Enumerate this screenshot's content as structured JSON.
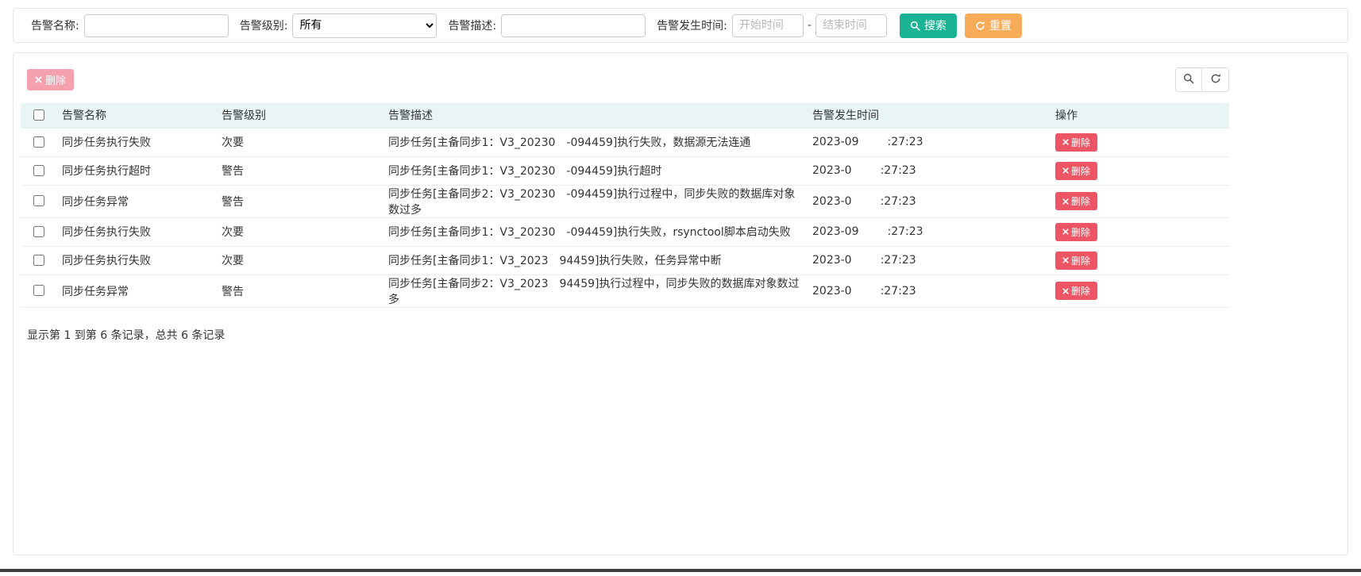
{
  "colors": {
    "search_button": "#1ab394",
    "reset_button": "#f8ac59",
    "delete_button": "#ed5565",
    "delete_button_disabled": "#f5a0ad",
    "table_header_bg": "#e9f5f5"
  },
  "icons": {
    "search": "magnifier",
    "reset": "refresh-arrows",
    "delete": "x-cross",
    "toolbar_search": "magnifier",
    "toolbar_refresh": "refresh-arrows"
  },
  "filters": {
    "name_label": "告警名称:",
    "level_label": "告警级别:",
    "level_value": "所有",
    "desc_label": "告警描述:",
    "time_label": "告警发生时间:",
    "start_placeholder": "开始时间",
    "end_placeholder": "结束时间",
    "range_separator": "-",
    "search_label": "搜索",
    "reset_label": "重置"
  },
  "toolbar": {
    "bulk_delete_label": "删除"
  },
  "table": {
    "headers": [
      "告警名称",
      "告警级别",
      "告警描述",
      "告警发生时间",
      "操作"
    ],
    "row_delete_label": "删除",
    "rows": [
      {
        "name": "同步任务执行失败",
        "level": "次要",
        "desc_prefix": "同步任务[主备同步1：V3_20230",
        "desc_suffix": "-094459]执行失败，数据源无法连通",
        "time_prefix": "2023-09",
        "time_suffix": ":27:23"
      },
      {
        "name": "同步任务执行超时",
        "level": "警告",
        "desc_prefix": "同步任务[主备同步1：V3_20230",
        "desc_suffix": "-094459]执行超时",
        "time_prefix": "2023-0",
        "time_suffix": ":27:23"
      },
      {
        "name": "同步任务异常",
        "level": "警告",
        "desc_prefix": "同步任务[主备同步2：V3_20230",
        "desc_suffix": "-094459]执行过程中，同步失败的数据库对象数过多",
        "time_prefix": "2023-0",
        "time_suffix": ":27:23"
      },
      {
        "name": "同步任务执行失败",
        "level": "次要",
        "desc_prefix": "同步任务[主备同步1：V3_20230",
        "desc_suffix": "-094459]执行失败，rsynctool脚本启动失败",
        "time_prefix": "2023-09",
        "time_suffix": ":27:23"
      },
      {
        "name": "同步任务执行失败",
        "level": "次要",
        "desc_prefix": "同步任务[主备同步1：V3_2023",
        "desc_suffix": "94459]执行失败，任务异常中断",
        "time_prefix": "2023-0",
        "time_suffix": ":27:23"
      },
      {
        "name": "同步任务异常",
        "level": "警告",
        "desc_prefix": "同步任务[主备同步2：V3_2023",
        "desc_suffix": "94459]执行过程中，同步失败的数据库对象数过多",
        "time_prefix": "2023-0",
        "time_suffix": ":27:23"
      }
    ]
  },
  "footer": {
    "summary": "显示第 1 到第 6 条记录，总共 6 条记录"
  }
}
